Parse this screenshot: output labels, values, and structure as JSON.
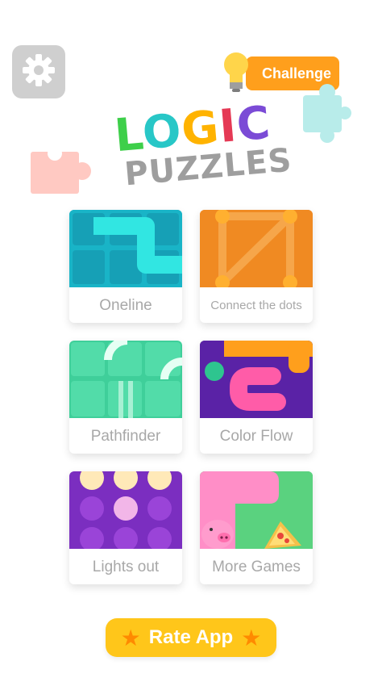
{
  "header": {
    "settings_icon": "gear-icon",
    "challenge_label": "Challenge",
    "challenge_icon": "lightbulb-icon"
  },
  "logo": {
    "line1": [
      "L",
      "O",
      "G",
      "I",
      "C"
    ],
    "line1_colors": [
      "#3ecf4a",
      "#28c7c7",
      "#ffb300",
      "#e53955",
      "#7b4bd6"
    ],
    "line2": "PUZZLES"
  },
  "games": [
    {
      "label": "Oneline"
    },
    {
      "label": "Connect the dots"
    },
    {
      "label": "Pathfinder"
    },
    {
      "label": "Color Flow"
    },
    {
      "label": "Lights out"
    },
    {
      "label": "More Games"
    }
  ],
  "rate": {
    "label": "Rate App",
    "icon": "star-icon"
  }
}
